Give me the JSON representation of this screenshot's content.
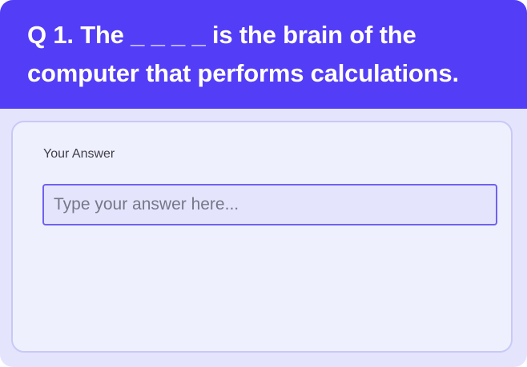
{
  "question": {
    "text": "Q 1. The _ _ _ _ is the brain of the computer that performs calculations."
  },
  "answer": {
    "label": "Your Answer",
    "value": "",
    "placeholder": "Type your answer here..."
  },
  "colors": {
    "header_background": "#533DF6",
    "panel_background": "#EFF0FE",
    "page_background": "#E4E4FD",
    "input_border": "#6F61EE"
  }
}
